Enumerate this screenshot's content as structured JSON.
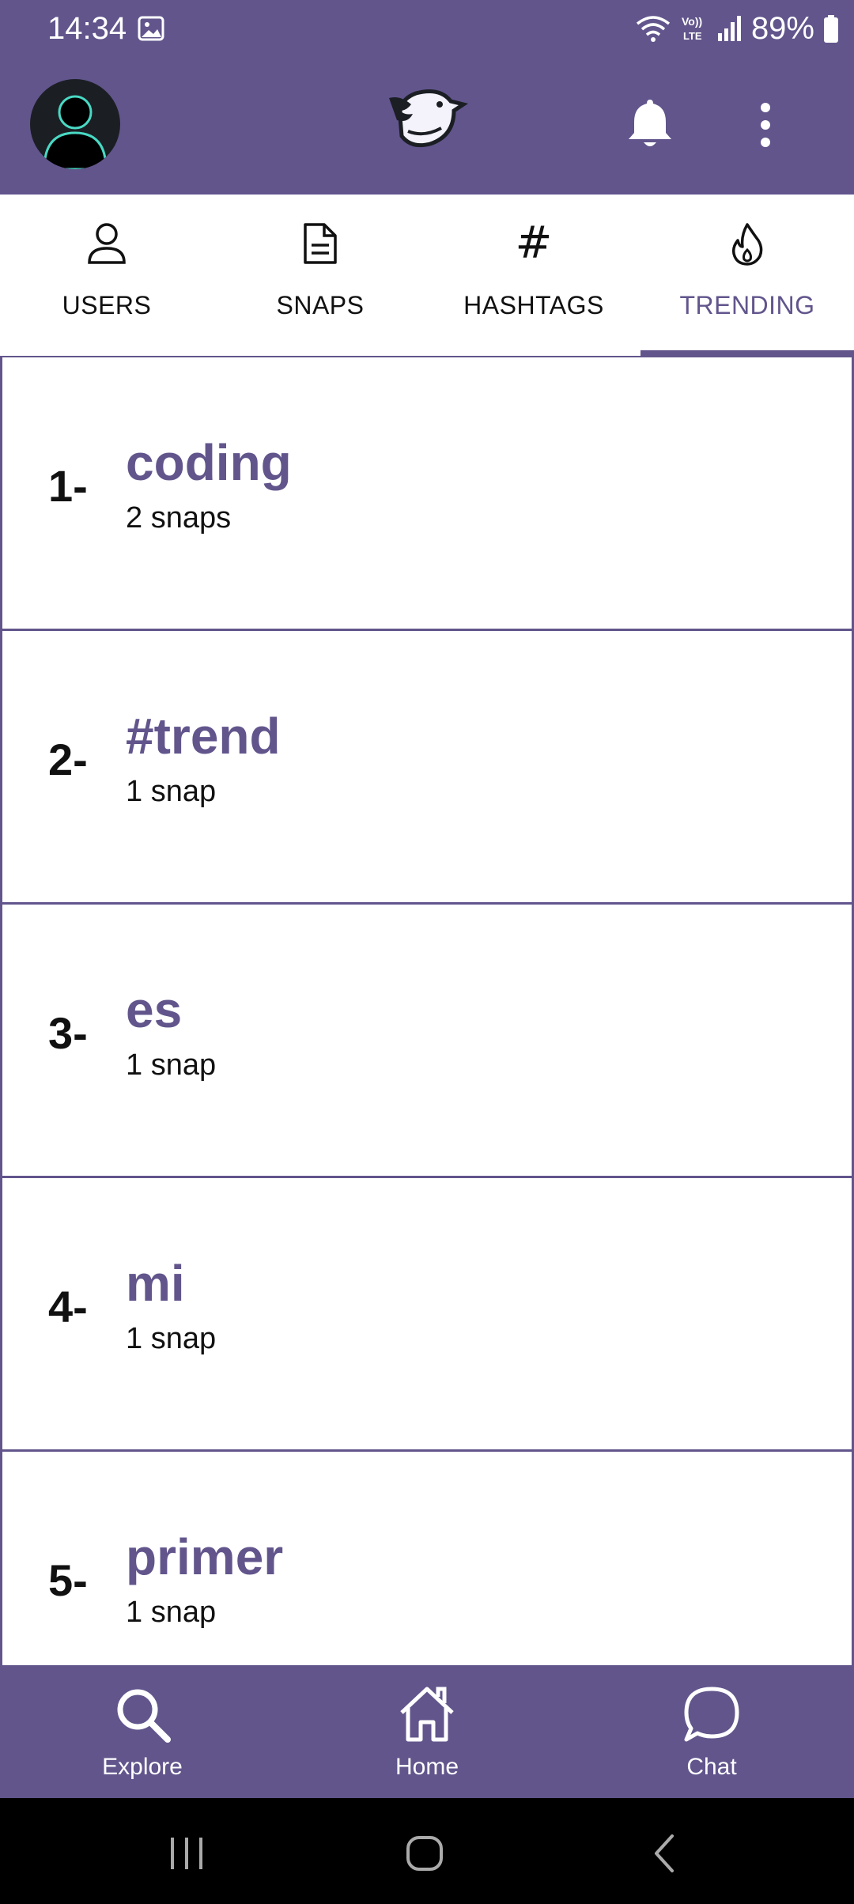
{
  "status_bar": {
    "time": "14:34",
    "battery": "89%",
    "icons": [
      "gallery-icon",
      "wifi-icon",
      "volte-icon",
      "signal-icon",
      "battery-icon"
    ]
  },
  "header": {
    "icons": [
      "avatar",
      "app-logo-bird",
      "bell-icon",
      "more-vert-icon"
    ]
  },
  "tabs": [
    {
      "label": "USERS",
      "icon": "person-icon",
      "active": false
    },
    {
      "label": "SNAPS",
      "icon": "document-icon",
      "active": false
    },
    {
      "label": "HASHTAGS",
      "icon": "hash-icon",
      "active": false
    },
    {
      "label": "TRENDING",
      "icon": "flame-icon",
      "active": true
    }
  ],
  "trending": [
    {
      "rank": "1-",
      "tag": "coding",
      "count": "2 snaps"
    },
    {
      "rank": "2-",
      "tag": "#trend",
      "count": "1 snap"
    },
    {
      "rank": "3-",
      "tag": "es",
      "count": "1 snap"
    },
    {
      "rank": "4-",
      "tag": "mi",
      "count": "1 snap"
    },
    {
      "rank": "5-",
      "tag": "primer",
      "count": "1 snap"
    }
  ],
  "bottom_nav": [
    {
      "label": "Explore",
      "icon": "search-icon"
    },
    {
      "label": "Home",
      "icon": "home-icon"
    },
    {
      "label": "Chat",
      "icon": "chat-icon"
    }
  ],
  "colors": {
    "primary": "#62558c",
    "text": "#111111",
    "background": "#ffffff"
  }
}
